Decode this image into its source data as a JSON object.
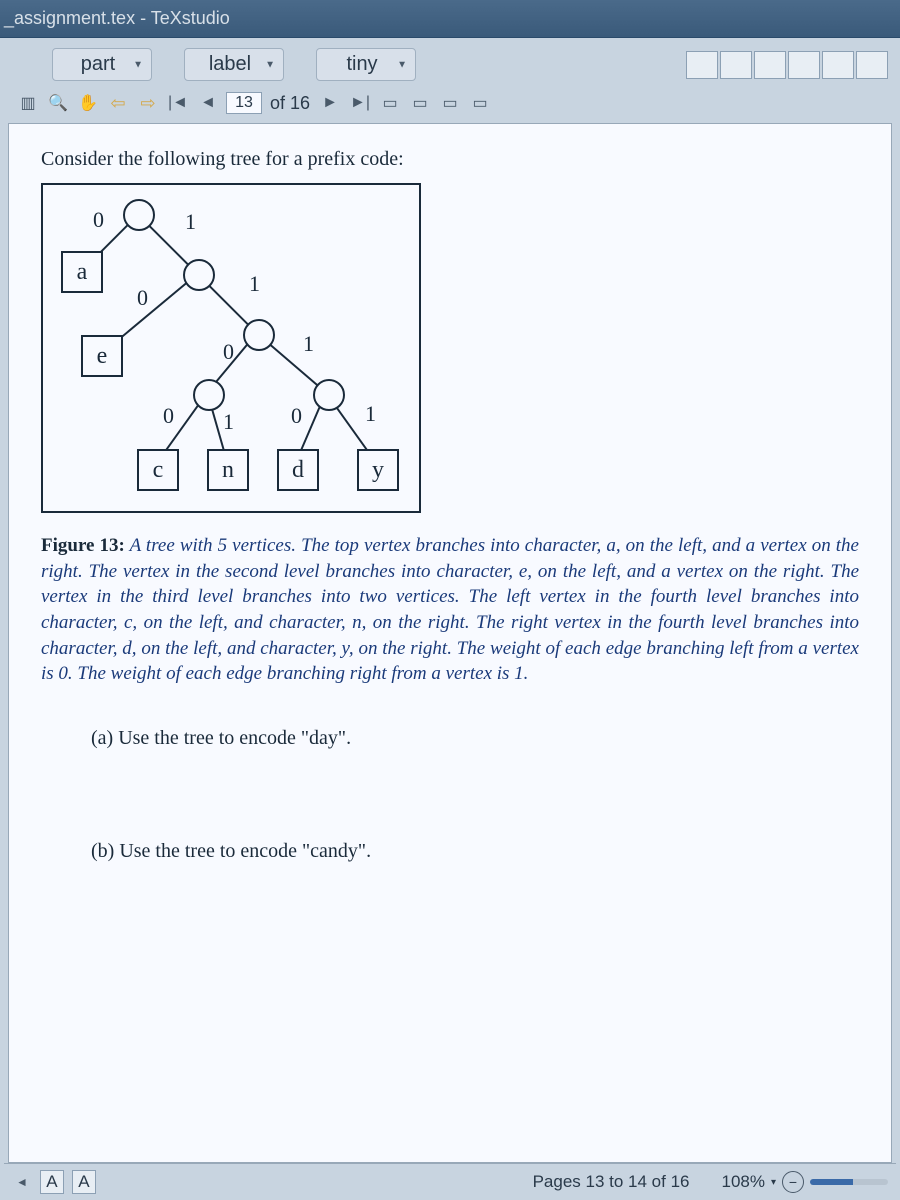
{
  "window": {
    "title": "_assignment.tex - TeXstudio"
  },
  "toolbar": {
    "dropdown1": "part",
    "dropdown2": "label",
    "dropdown3": "tiny"
  },
  "nav": {
    "page_input": "13",
    "of_label": "of 16"
  },
  "document": {
    "intro": "Consider the following tree for a prefix code:",
    "tree": {
      "leaves": {
        "a": "a",
        "e": "e",
        "c": "c",
        "n": "n",
        "d": "d",
        "y": "y"
      },
      "edges": {
        "e0": "0",
        "e1": "1",
        "e2": "0",
        "e3": "1",
        "e4": "0",
        "e5": "1",
        "e6": "0",
        "e7": "1",
        "e8": "0",
        "e9": "1"
      }
    },
    "caption_label": "Figure 13:",
    "caption_body": " A tree with 5 vertices. The top vertex branches into character, a, on the left, and a vertex on the right. The vertex in the second level branches into character, e, on the left, and a vertex on the right. The vertex in the third level branches into two vertices. The left vertex in the fourth level branches into character, c, on the left, and character, n, on the right. The right vertex in the fourth level branches into character, d, on the left, and character, y, on the right. The weight of each edge branching left from a vertex is 0. The weight of each edge branching right from a vertex is 1.",
    "qa": "(a)  Use the tree to encode \"day\".",
    "qb": "(b)  Use the tree to encode \"candy\"."
  },
  "status": {
    "pages": "Pages 13 to 14 of 16",
    "zoom": "108%"
  }
}
